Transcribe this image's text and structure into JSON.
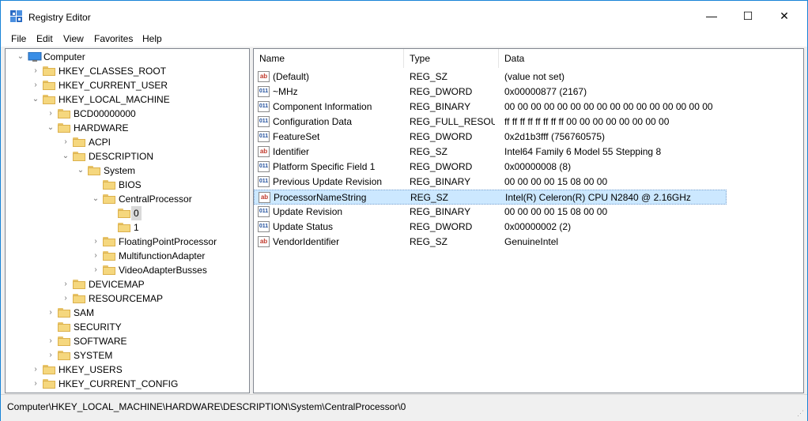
{
  "window": {
    "title": "Registry Editor",
    "minimize": "—",
    "maximize": "☐",
    "close": "✕"
  },
  "menu": [
    "File",
    "Edit",
    "View",
    "Favorites",
    "Help"
  ],
  "tree": [
    {
      "label": "Computer",
      "depth": 0,
      "expander": "expanded",
      "icon": "computer"
    },
    {
      "label": "HKEY_CLASSES_ROOT",
      "depth": 1,
      "expander": "collapsed",
      "icon": "folder"
    },
    {
      "label": "HKEY_CURRENT_USER",
      "depth": 1,
      "expander": "collapsed",
      "icon": "folder"
    },
    {
      "label": "HKEY_LOCAL_MACHINE",
      "depth": 1,
      "expander": "expanded",
      "icon": "folder"
    },
    {
      "label": "BCD00000000",
      "depth": 2,
      "expander": "collapsed",
      "icon": "folder"
    },
    {
      "label": "HARDWARE",
      "depth": 2,
      "expander": "expanded",
      "icon": "folder"
    },
    {
      "label": "ACPI",
      "depth": 3,
      "expander": "collapsed",
      "icon": "folder"
    },
    {
      "label": "DESCRIPTION",
      "depth": 3,
      "expander": "expanded",
      "icon": "folder"
    },
    {
      "label": "System",
      "depth": 4,
      "expander": "expanded",
      "icon": "folder"
    },
    {
      "label": "BIOS",
      "depth": 5,
      "expander": "none",
      "icon": "folder"
    },
    {
      "label": "CentralProcessor",
      "depth": 5,
      "expander": "expanded",
      "icon": "folder"
    },
    {
      "label": "0",
      "depth": 6,
      "expander": "none",
      "icon": "folder",
      "selected": true
    },
    {
      "label": "1",
      "depth": 6,
      "expander": "none",
      "icon": "folder"
    },
    {
      "label": "FloatingPointProcessor",
      "depth": 5,
      "expander": "collapsed",
      "icon": "folder"
    },
    {
      "label": "MultifunctionAdapter",
      "depth": 5,
      "expander": "collapsed",
      "icon": "folder"
    },
    {
      "label": "VideoAdapterBusses",
      "depth": 5,
      "expander": "collapsed",
      "icon": "folder"
    },
    {
      "label": "DEVICEMAP",
      "depth": 3,
      "expander": "collapsed",
      "icon": "folder"
    },
    {
      "label": "RESOURCEMAP",
      "depth": 3,
      "expander": "collapsed",
      "icon": "folder"
    },
    {
      "label": "SAM",
      "depth": 2,
      "expander": "collapsed",
      "icon": "folder"
    },
    {
      "label": "SECURITY",
      "depth": 2,
      "expander": "none",
      "icon": "folder"
    },
    {
      "label": "SOFTWARE",
      "depth": 2,
      "expander": "collapsed",
      "icon": "folder"
    },
    {
      "label": "SYSTEM",
      "depth": 2,
      "expander": "collapsed",
      "icon": "folder"
    },
    {
      "label": "HKEY_USERS",
      "depth": 1,
      "expander": "collapsed",
      "icon": "folder"
    },
    {
      "label": "HKEY_CURRENT_CONFIG",
      "depth": 1,
      "expander": "collapsed",
      "icon": "folder"
    }
  ],
  "columns": {
    "name": "Name",
    "type": "Type",
    "data": "Data"
  },
  "values": [
    {
      "name": "(Default)",
      "type": "REG_SZ",
      "data": "(value not set)",
      "icon": "string-value-icon"
    },
    {
      "name": "~MHz",
      "type": "REG_DWORD",
      "data": "0x00000877 (2167)",
      "icon": "binary-value-icon"
    },
    {
      "name": "Component Information",
      "type": "REG_BINARY",
      "data": "00 00 00 00 00 00 00 00 00 00 00 00 00 00 00 00",
      "icon": "binary-value-icon"
    },
    {
      "name": "Configuration Data",
      "type": "REG_FULL_RESOU...",
      "data": "ff ff ff ff ff ff ff ff 00 00 00 00 00 00 00 00",
      "icon": "binary-value-icon"
    },
    {
      "name": "FeatureSet",
      "type": "REG_DWORD",
      "data": "0x2d1b3fff (756760575)",
      "icon": "binary-value-icon"
    },
    {
      "name": "Identifier",
      "type": "REG_SZ",
      "data": "Intel64 Family 6 Model 55 Stepping 8",
      "icon": "string-value-icon"
    },
    {
      "name": "Platform Specific Field 1",
      "type": "REG_DWORD",
      "data": "0x00000008 (8)",
      "icon": "binary-value-icon"
    },
    {
      "name": "Previous Update Revision",
      "type": "REG_BINARY",
      "data": "00 00 00 00 15 08 00 00",
      "icon": "binary-value-icon"
    },
    {
      "name": "ProcessorNameString",
      "type": "REG_SZ",
      "data": "Intel(R) Celeron(R) CPU  N2840  @ 2.16GHz",
      "icon": "string-value-icon",
      "selected": true
    },
    {
      "name": "Update Revision",
      "type": "REG_BINARY",
      "data": "00 00 00 00 15 08 00 00",
      "icon": "binary-value-icon"
    },
    {
      "name": "Update Status",
      "type": "REG_DWORD",
      "data": "0x00000002 (2)",
      "icon": "binary-value-icon"
    },
    {
      "name": "VendorIdentifier",
      "type": "REG_SZ",
      "data": "GenuineIntel",
      "icon": "string-value-icon"
    }
  ],
  "icons": {
    "string": "ab",
    "binary": "011"
  },
  "status": "Computer\\HKEY_LOCAL_MACHINE\\HARDWARE\\DESCRIPTION\\System\\CentralProcessor\\0",
  "colors": {
    "selection": "#cce8ff",
    "tree_selection": "#d9d9d9",
    "accent": "#1883d7"
  }
}
